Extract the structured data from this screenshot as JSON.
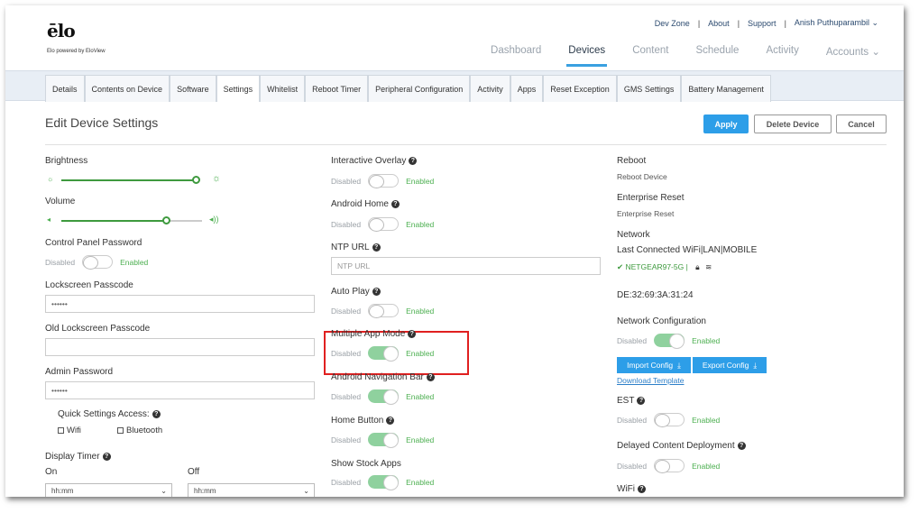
{
  "header": {
    "logo": "ēlo",
    "logo_sub": "Elo powered by EloView",
    "top_links": [
      "Dev Zone",
      "About",
      "Support",
      "Anish Puthuparambil ⌄"
    ],
    "main_nav": [
      "Dashboard",
      "Devices",
      "Content",
      "Schedule",
      "Activity",
      "Accounts ⌄"
    ]
  },
  "tabs": [
    "Details",
    "Contents on Device",
    "Software",
    "Settings",
    "Whitelist",
    "Reboot Timer",
    "Peripheral Configuration",
    "Activity",
    "Apps",
    "Reset Exception",
    "GMS Settings",
    "Battery Management"
  ],
  "page": {
    "title": "Edit Device Settings",
    "apply": "Apply",
    "delete": "Delete Device",
    "cancel": "Cancel"
  },
  "toggle_text": {
    "disabled": "Disabled",
    "enabled": "Enabled"
  },
  "left": {
    "brightness": "Brightness",
    "volume": "Volume",
    "brightness_level": 0.88,
    "volume_level": 0.75,
    "control_panel_password": "Control Panel Password",
    "lockscreen_passcode": "Lockscreen Passcode",
    "lockscreen_value": "••••••",
    "old_lockscreen_passcode": "Old Lockscreen Passcode",
    "admin_password": "Admin Password",
    "admin_value": "••••••",
    "quick_settings": "Quick Settings Access:",
    "wifi": "Wifi",
    "bluetooth": "Bluetooth",
    "display_timer": "Display Timer",
    "on": "On",
    "off": "Off",
    "time_placeholder": "hh:mm"
  },
  "middle": {
    "interactive_overlay": "Interactive Overlay",
    "android_home": "Android Home",
    "ntp_url": "NTP URL",
    "ntp_placeholder": "NTP URL",
    "auto_play": "Auto Play",
    "multiple_app_mode": "Multiple App Mode",
    "android_nav_bar": "Android Navigation Bar",
    "home_button": "Home Button",
    "show_stock_apps": "Show Stock Apps"
  },
  "right": {
    "reboot": "Reboot",
    "reboot_device": "Reboot Device",
    "enterprise_reset": "Enterprise Reset",
    "enterprise_reset_sub": "Enterprise Reset",
    "network": "Network",
    "last_connected": "Last Connected WiFi|LAN|MOBILE",
    "wifi_name": "NETGEAR97-5G |",
    "mac": "DE:32:69:3A:31:24",
    "network_config": "Network Configuration",
    "import_config": "Import Config",
    "export_config": "Export Config",
    "download_template": "Download Template",
    "est": "EST",
    "delayed_content": "Delayed Content Deployment",
    "wifi_label": "WiFi"
  }
}
